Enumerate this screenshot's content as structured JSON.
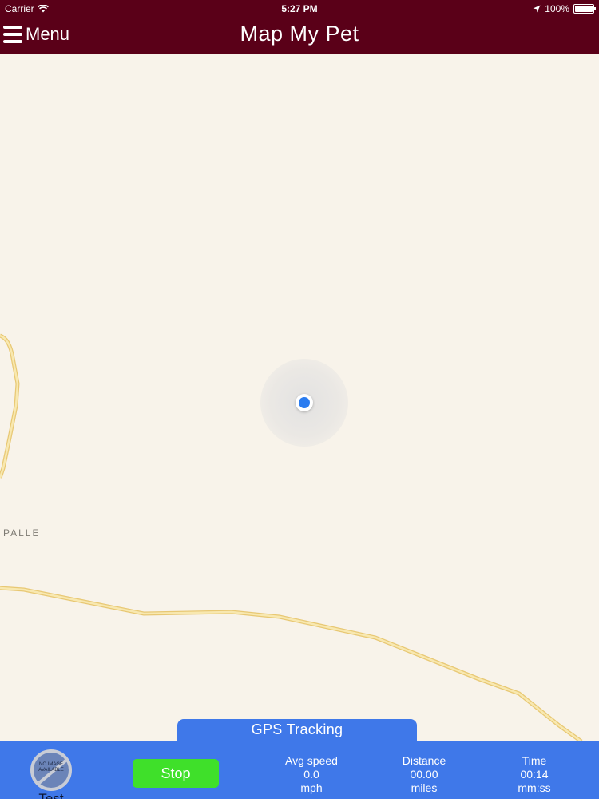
{
  "status_bar": {
    "carrier": "Carrier",
    "time": "5:27 PM",
    "battery": "100%"
  },
  "nav": {
    "menu_label": "Menu",
    "title": "Map My Pet"
  },
  "map": {
    "place_label": "PALLE",
    "road_color": "#f0d98a"
  },
  "tracking": {
    "tab_label": "GPS Tracking",
    "test_label": "Test",
    "no_image_text": "NO IMAGE AVAILABLE",
    "stop_label": "Stop",
    "stats": [
      {
        "label": "Avg speed",
        "value": "0.0",
        "unit": "mph"
      },
      {
        "label": "Distance",
        "value": "00.00",
        "unit": "miles"
      },
      {
        "label": "Time",
        "value": "00:14",
        "unit": "mm:ss"
      }
    ]
  },
  "colors": {
    "nav_background": "#5a0018",
    "bottom_bar_background": "#3f78e9",
    "stop_button": "#3fe02a",
    "location_dot": "#2a7cf0"
  }
}
